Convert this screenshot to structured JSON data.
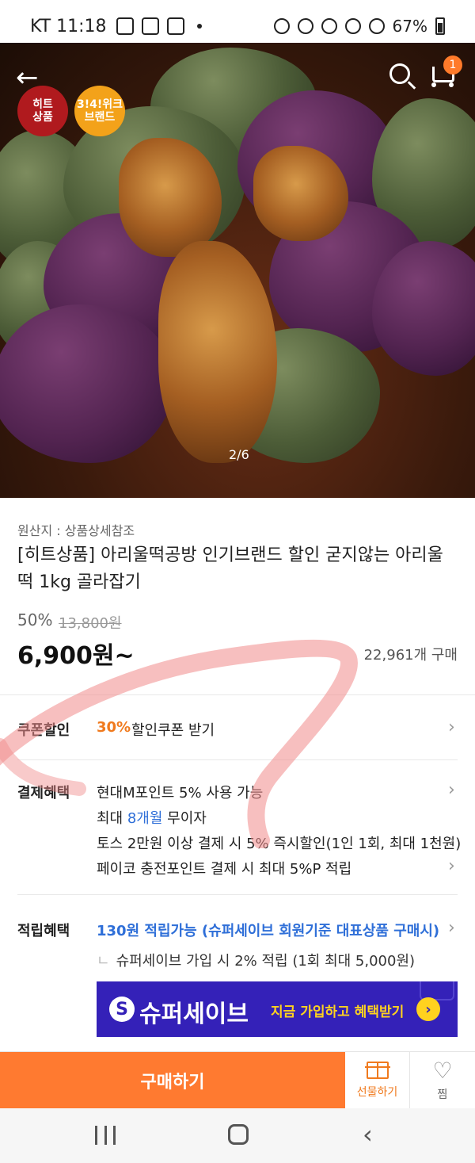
{
  "status_bar": {
    "carrier_time": "KT 11:18",
    "battery": "67%"
  },
  "hero": {
    "badges": [
      {
        "label": "히트\n상품",
        "color": "#b01a1e"
      },
      {
        "label": "3!4!위크\n브랜드",
        "color": "#f3a21a"
      }
    ],
    "cart_count": "1",
    "pager": "2/6"
  },
  "product": {
    "origin": "원산지 : 상품상세참조",
    "title": "[히트상품] 아리울떡공방 인기브랜드 할인 굳지않는 아리울떡 1kg 골라잡기",
    "discount": "50%",
    "original_price": "13,800원",
    "price": "6,900원~",
    "sold": "22,961개 구매"
  },
  "coupon": {
    "label": "쿠폰할인",
    "percent": "30%",
    "text": "할인쿠폰 받기"
  },
  "payment": {
    "label": "결제혜택",
    "line1": "현대M포인트 5% 사용 가능",
    "line2_prefix": "최대 ",
    "line2_highlight": "8개월",
    "line2_suffix": " 무이자",
    "line3": "토스 2만원 이상 결제 시 5% 즉시할인(1인 1회, 최대 1천원)",
    "line4": "페이코 충전포인트 결제 시 최대 5%P 적립"
  },
  "reward": {
    "label": "적립혜택",
    "line1": "130원 적립가능 (슈퍼세이브 회원기준 대표상품 구매시)",
    "line2": "슈퍼세이브 가입 시 2% 적립 (1회 최대 5,000원)",
    "hook": "ㄴ"
  },
  "banner": {
    "s_mark": "S",
    "brand": "슈퍼세이브",
    "cta": "지금 가입하고 혜택받기",
    "arrow": "›"
  },
  "bottom": {
    "buy": "구매하기",
    "gift": "선물하기",
    "like": "찜"
  },
  "colors": {
    "accent": "#ff7a30",
    "discount_text": "#f07a1e",
    "link_blue": "#2f6fd8",
    "banner_bg": "#3421b8",
    "banner_cta": "#ffd21f"
  },
  "icons": {
    "back": "back-arrow-icon",
    "search": "search-icon",
    "cart": "cart-icon",
    "chevron": "chevron-right-icon",
    "gift": "gift-icon",
    "heart": "heart-icon"
  }
}
